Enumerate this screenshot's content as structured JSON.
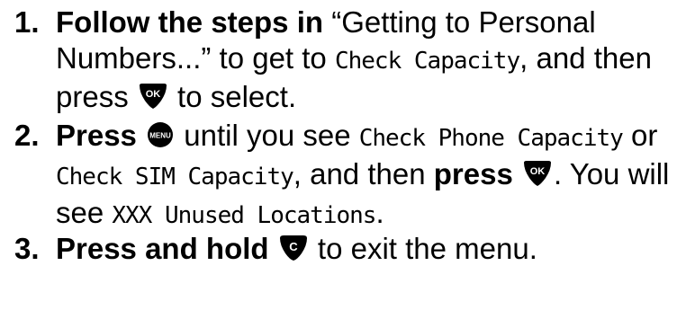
{
  "steps": [
    {
      "number": "1.",
      "bold_lead": "Follow the steps in",
      "t1": " “Getting to Personal Numbers...” to get to ",
      "lcd1": "Check Capacity",
      "t2": ", and then press ",
      "key": "OK",
      "t3": " to select."
    },
    {
      "number": "2.",
      "bold_lead": "Press",
      "key1": "MENU",
      "t1": " until you see ",
      "lcd1": "Check Phone Capacity",
      "t2": " or ",
      "lcd2": "Check SIM Capacity",
      "t3": ", and then ",
      "bold2": "press",
      "key2": "OK",
      "t4": ". You will see ",
      "lcd3": "XXX Unused Locations",
      "t5": "."
    },
    {
      "number": "3.",
      "bold_lead": "Press and hold",
      "key": "C",
      "t1": " to exit the menu."
    }
  ]
}
